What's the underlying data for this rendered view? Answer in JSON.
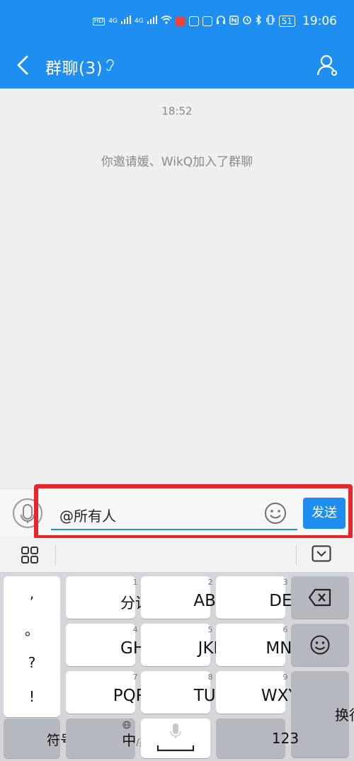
{
  "status_bar": {
    "time": "19:06",
    "battery": "51",
    "net1": "4G",
    "net2": "4G",
    "hd1": "HD",
    "hd2": "HD"
  },
  "title_bar": {
    "title": "群聊(3)"
  },
  "chat": {
    "timestamp": "18:52",
    "system_message": "你邀请媛、WikQ加入了群聊"
  },
  "input_bar": {
    "text": "@所有人",
    "send_label": "发送"
  },
  "keyboard": {
    "punct": [
      ",",
      "。",
      "?",
      "!"
    ],
    "keys_row1": [
      {
        "num": "1",
        "label": "分词"
      },
      {
        "num": "2",
        "label": "ABC"
      },
      {
        "num": "3",
        "label": "DEF"
      }
    ],
    "keys_row2": [
      {
        "num": "4",
        "label": "GHI"
      },
      {
        "num": "5",
        "label": "JKL"
      },
      {
        "num": "6",
        "label": "MNO"
      }
    ],
    "keys_row3": [
      {
        "num": "7",
        "label": "PQRS"
      },
      {
        "num": "8",
        "label": "TUV"
      },
      {
        "num": "9",
        "label": "WXYZ"
      }
    ],
    "symbols_label": "符号",
    "lang_label": "中",
    "lang_sub": "/英",
    "num_label": "123",
    "enter_label": "换行"
  },
  "colors": {
    "accent": "#1e8ef0",
    "highlight_border": "#e8262a"
  }
}
